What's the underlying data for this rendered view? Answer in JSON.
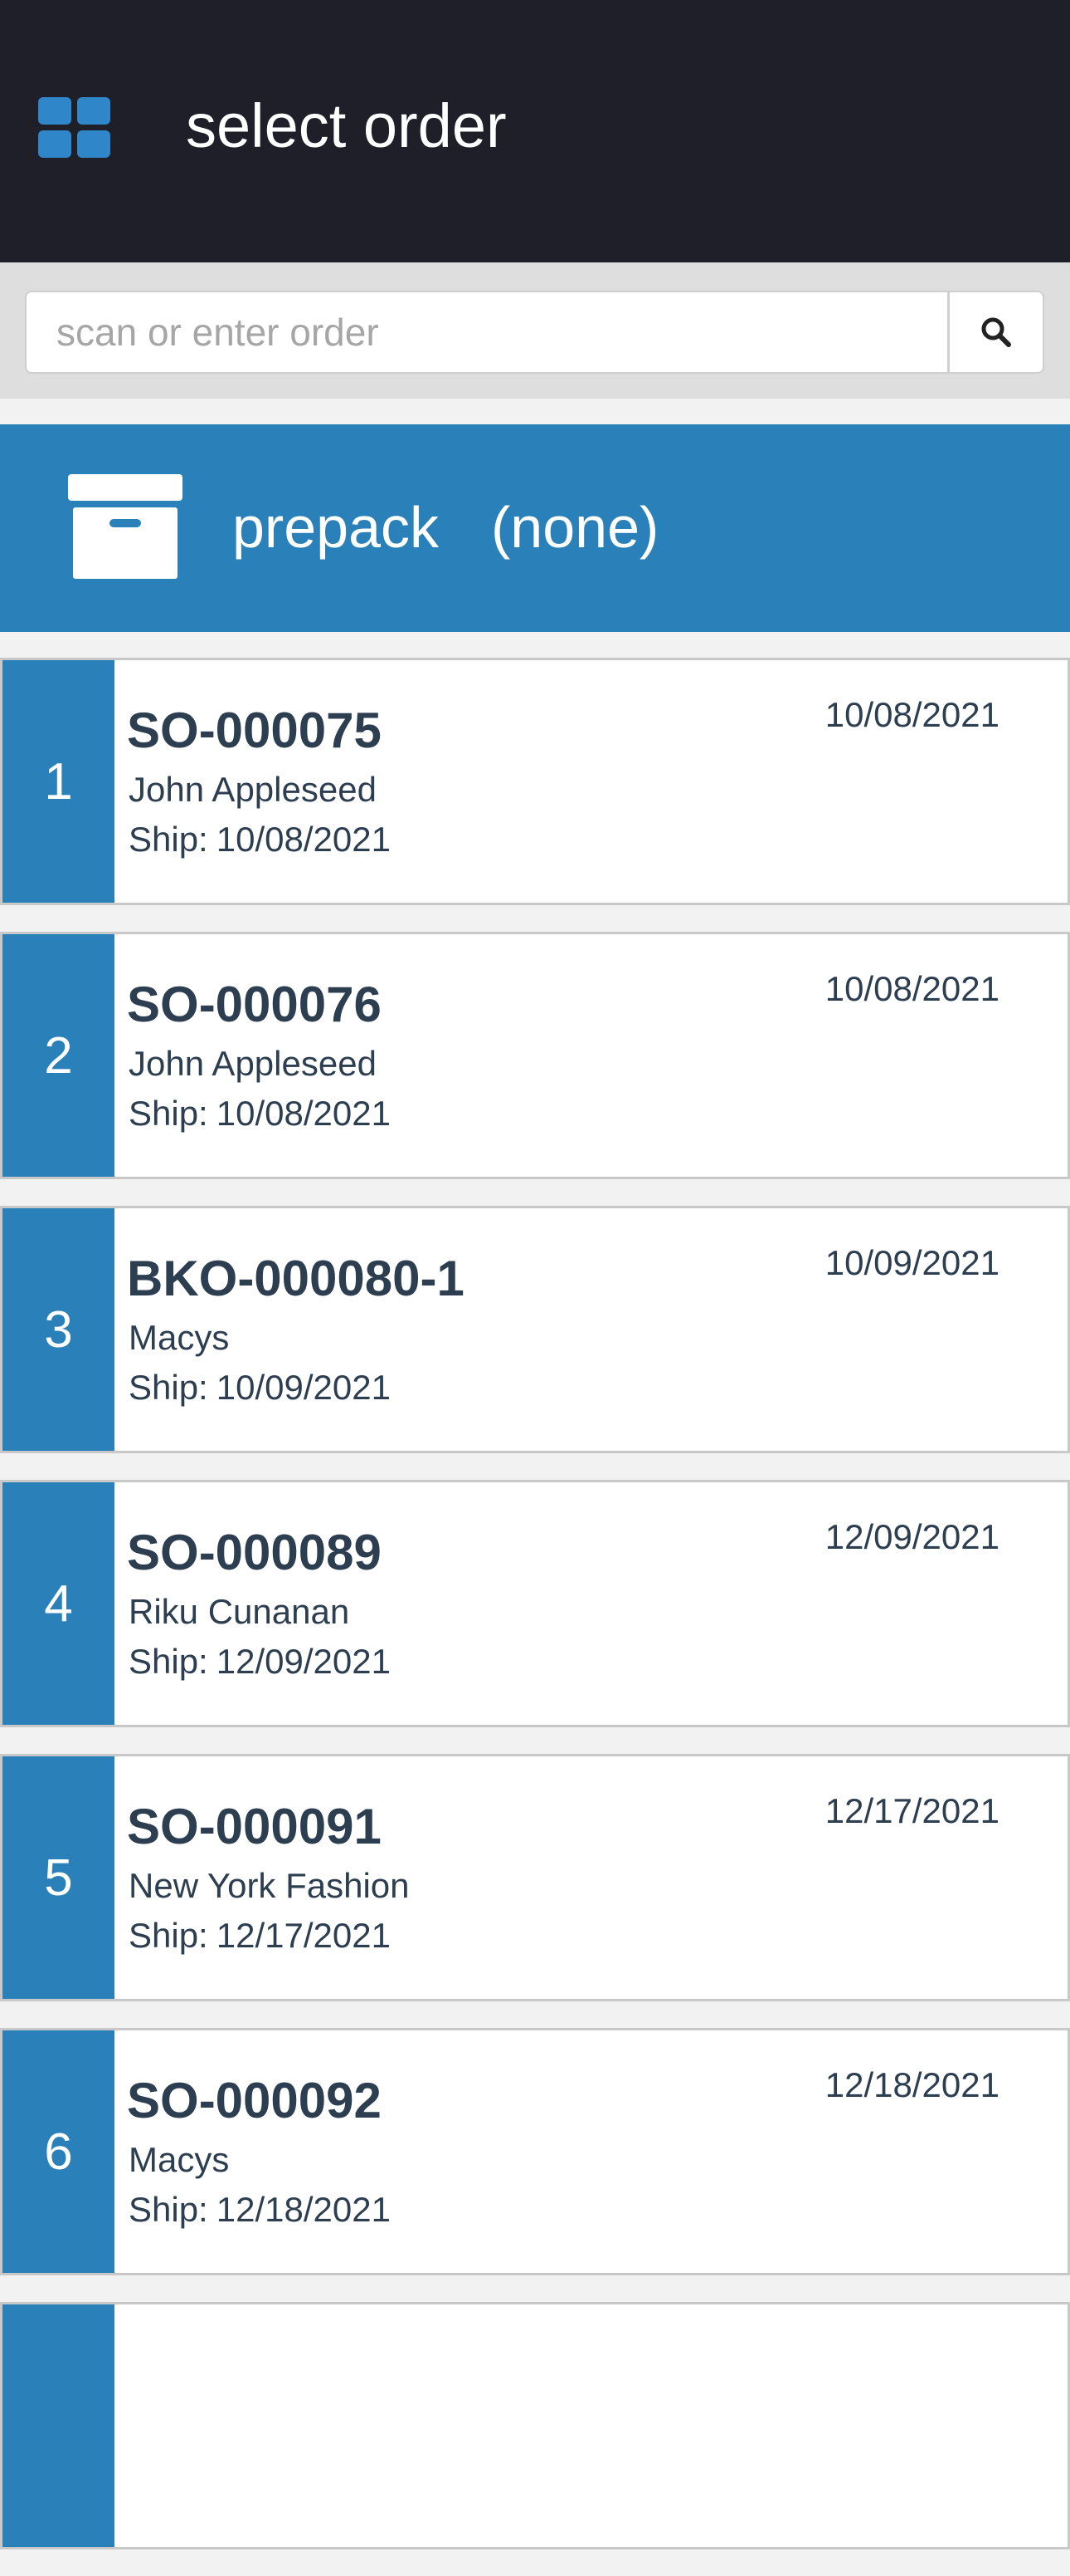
{
  "header": {
    "title": "select order",
    "menu_icon": "grid-icon",
    "background": "#1e1f29"
  },
  "search": {
    "placeholder": "scan or enter order",
    "value": "",
    "button_icon": "search-icon"
  },
  "prepack": {
    "label": "prepack",
    "value": "(none)",
    "icon": "archive-box-icon",
    "color": "#2a80b9"
  },
  "ship_prefix": "Ship:",
  "orders": [
    {
      "index": "1",
      "number": "SO-000075",
      "customer": "John Appleseed",
      "ship_date": "10/08/2021",
      "date": "10/08/2021"
    },
    {
      "index": "2",
      "number": "SO-000076",
      "customer": "John Appleseed",
      "ship_date": "10/08/2021",
      "date": "10/08/2021"
    },
    {
      "index": "3",
      "number": "BKO-000080-1",
      "customer": "Macys",
      "ship_date": "10/09/2021",
      "date": "10/09/2021"
    },
    {
      "index": "4",
      "number": "SO-000089",
      "customer": "Riku Cunanan",
      "ship_date": "12/09/2021",
      "date": "12/09/2021"
    },
    {
      "index": "5",
      "number": "SO-000091",
      "customer": "New York Fashion",
      "ship_date": "12/17/2021",
      "date": "12/17/2021"
    },
    {
      "index": "6",
      "number": "SO-000092",
      "customer": "Macys",
      "ship_date": "12/18/2021",
      "date": "12/18/2021"
    },
    {
      "index": "",
      "number": "",
      "customer": "",
      "ship_date": "",
      "date": ""
    }
  ]
}
